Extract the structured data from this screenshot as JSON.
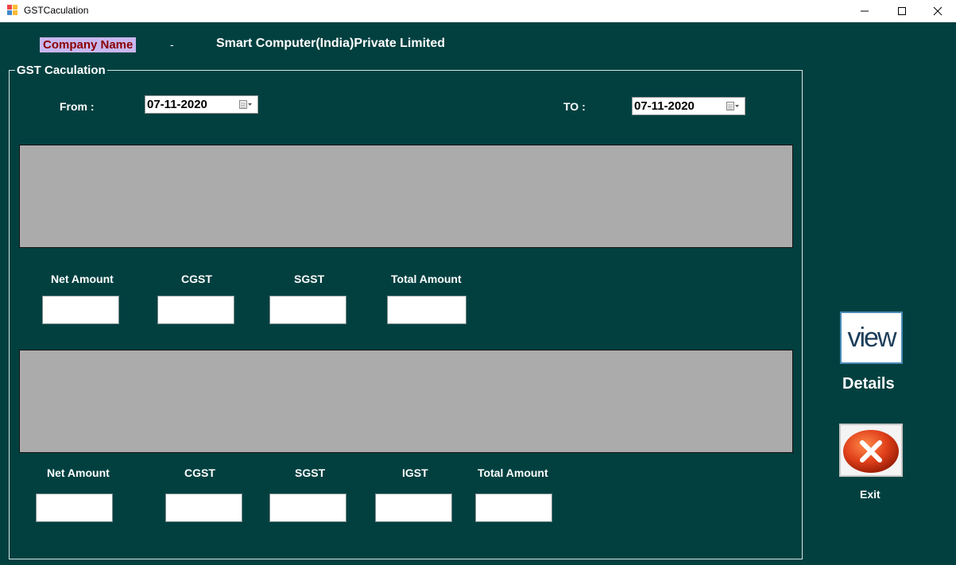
{
  "window": {
    "title": "GSTCaculation",
    "minimize_icon": "minimize-icon",
    "maximize_icon": "maximize-icon",
    "close_icon": "close-icon"
  },
  "header": {
    "company_label": "Company Name",
    "separator": "-",
    "company_value": "Smart Computer(India)Private Limited"
  },
  "group": {
    "title": "GST Caculation",
    "from_label": "From  :",
    "from_value": "07-11-2020",
    "to_label": "TO  :",
    "to_value": "07-11-2020",
    "calendar_icon": "calendar-dropdown-icon"
  },
  "summary1": {
    "labels": [
      "Net Amount",
      "CGST",
      "SGST",
      "Total Amount"
    ],
    "values": [
      "",
      "",
      "",
      ""
    ]
  },
  "summary2": {
    "labels": [
      "Net Amount",
      "CGST",
      "SGST",
      "IGST",
      "Total Amount"
    ],
    "values": [
      "",
      "",
      "",
      "",
      ""
    ]
  },
  "actions": {
    "view_button_text": "view",
    "view_label": "Details",
    "exit_label": "Exit"
  },
  "colors": {
    "background": "#024040",
    "company_label_bg": "#c8b8f0",
    "company_label_fg": "#8b0000",
    "grid_bg": "#ababab"
  }
}
